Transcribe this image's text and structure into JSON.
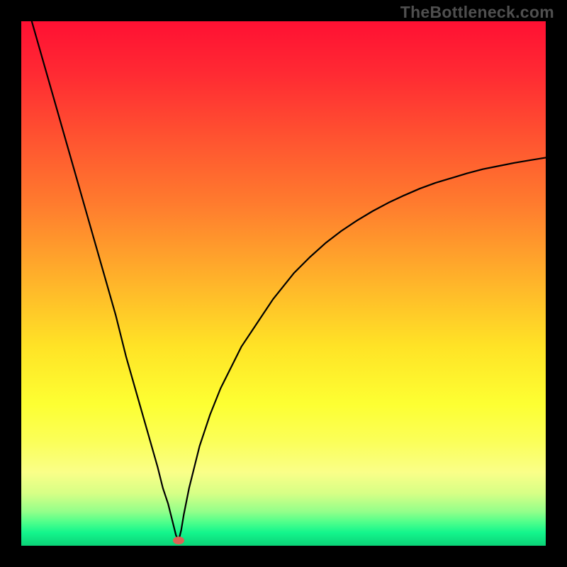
{
  "watermark": "TheBottleneck.com",
  "chart_data": {
    "type": "line",
    "title": "",
    "xlabel": "",
    "ylabel": "",
    "xlim": [
      0,
      100
    ],
    "ylim": [
      0,
      100
    ],
    "grid": false,
    "legend": false,
    "marker": {
      "x": 30,
      "y": 1
    },
    "series": [
      {
        "name": "left-branch",
        "x": [
          2,
          4,
          6,
          8,
          10,
          12,
          14,
          16,
          18,
          20,
          22,
          24,
          26,
          27,
          28,
          29,
          29.5,
          30
        ],
        "y": [
          100,
          93,
          86,
          79,
          72,
          65,
          58,
          51,
          44,
          36,
          29,
          22,
          15,
          11,
          8,
          4,
          2,
          1
        ]
      },
      {
        "name": "right-branch",
        "x": [
          30,
          30.5,
          31,
          32,
          33,
          34,
          35,
          36,
          38,
          40,
          42,
          44,
          46,
          48,
          50,
          52,
          55,
          58,
          61,
          64,
          67,
          70,
          73,
          76,
          79,
          82,
          85,
          88,
          91,
          94,
          97,
          100
        ],
        "y": [
          1,
          3,
          6,
          11,
          15,
          19,
          22,
          25,
          30,
          34,
          38,
          41,
          44,
          47,
          49.5,
          52,
          55,
          57.7,
          60,
          62,
          63.8,
          65.4,
          66.8,
          68.1,
          69.2,
          70.1,
          71,
          71.8,
          72.4,
          73,
          73.5,
          74
        ]
      }
    ]
  },
  "colors": {
    "gradient": [
      {
        "stop": 0.0,
        "hex": "#ff1033"
      },
      {
        "stop": 0.1,
        "hex": "#ff2a33"
      },
      {
        "stop": 0.22,
        "hex": "#ff5230"
      },
      {
        "stop": 0.35,
        "hex": "#ff7c2e"
      },
      {
        "stop": 0.5,
        "hex": "#ffb52a"
      },
      {
        "stop": 0.62,
        "hex": "#ffe326"
      },
      {
        "stop": 0.73,
        "hex": "#fdff32"
      },
      {
        "stop": 0.8,
        "hex": "#fbff58"
      },
      {
        "stop": 0.86,
        "hex": "#faff88"
      },
      {
        "stop": 0.9,
        "hex": "#d7ff86"
      },
      {
        "stop": 0.935,
        "hex": "#93ff8a"
      },
      {
        "stop": 0.955,
        "hex": "#4fff8b"
      },
      {
        "stop": 0.975,
        "hex": "#13f58c"
      },
      {
        "stop": 1.0,
        "hex": "#0bd377"
      }
    ],
    "line": "#000000",
    "marker": "#dd6255",
    "background": "#000000"
  }
}
